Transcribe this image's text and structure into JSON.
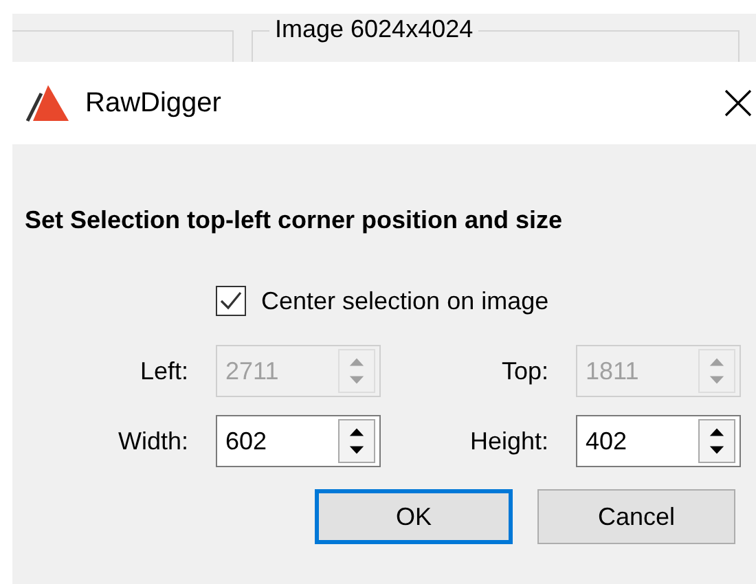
{
  "background": {
    "group_title": "Image 6024x4024"
  },
  "window": {
    "title": "RawDigger"
  },
  "dialog": {
    "heading": "Set Selection top-left corner position and size",
    "checkbox": {
      "label": "Center selection on image",
      "checked": true
    },
    "fields": [
      {
        "label": "Left:",
        "value": "2711",
        "disabled": true
      },
      {
        "label": "Top:",
        "value": "1811",
        "disabled": true
      },
      {
        "label": "Width:",
        "value": "602",
        "disabled": false
      },
      {
        "label": "Height:",
        "value": "402",
        "disabled": false
      }
    ],
    "buttons": [
      {
        "label": "OK",
        "default": true
      },
      {
        "label": "Cancel",
        "default": false
      }
    ]
  }
}
